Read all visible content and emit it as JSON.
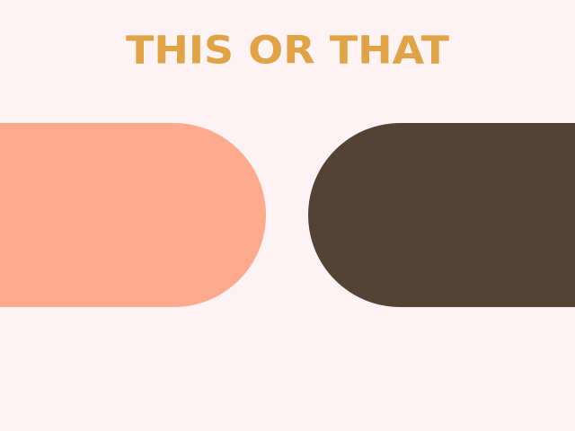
{
  "title": {
    "text": "THIS OR THAT",
    "color": "#e0a447"
  },
  "options": {
    "left": {
      "color": "#ffa98d"
    },
    "right": {
      "color": "#544235"
    }
  },
  "background_color": "#fdf3f5"
}
